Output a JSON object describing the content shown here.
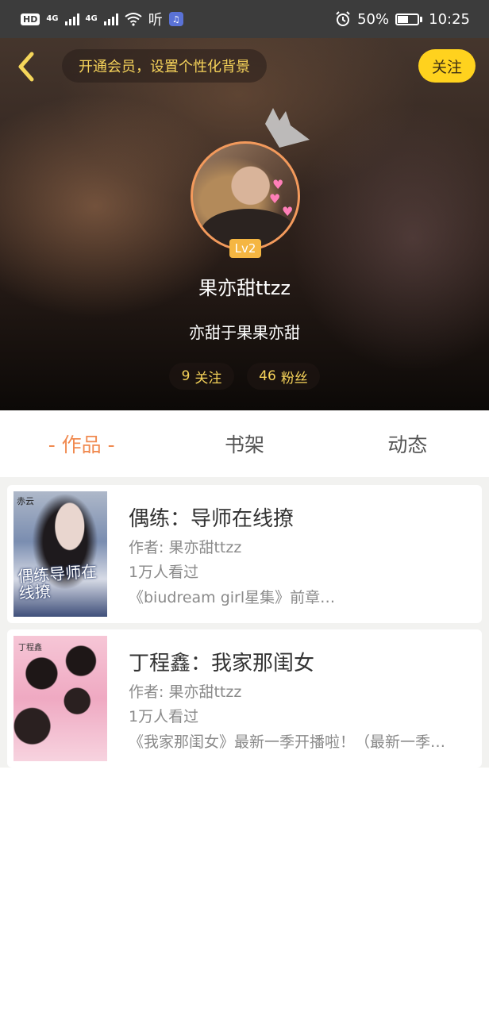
{
  "status_bar": {
    "hd_badge": "HD",
    "net_1": "4G",
    "net_2": "4G",
    "ting_label": "听",
    "battery": "50%",
    "time": "10:25"
  },
  "header": {
    "vip_prompt": "开通会员，设置个性化背景",
    "follow_label": "关注"
  },
  "profile": {
    "level": "Lv2",
    "username": "果亦甜ttzz",
    "bio": "亦甜于果果亦甜",
    "following_count": "9",
    "following_label": "关注",
    "fans_count": "46",
    "fans_label": "粉丝"
  },
  "tabs": [
    {
      "label": "- 作品 -",
      "active": true
    },
    {
      "label": "书架",
      "active": false
    },
    {
      "label": "动态",
      "active": false
    }
  ],
  "books": [
    {
      "title": "偶练：导师在线撩",
      "author": "作者: 果亦甜ttzz",
      "views": "1万人看过",
      "description": "《biudream  girl星集》前章…",
      "cover_text": "偶练导师在线撩"
    },
    {
      "title": "丁程鑫：我家那闺女",
      "author": "作者: 果亦甜ttzz",
      "views": "1万人看过",
      "description": "《我家那闺女》最新一季开播啦！（最新一季…"
    }
  ],
  "colors": {
    "accent_orange": "#f08a50",
    "follow_yellow": "#ffd21e",
    "gold_text": "#f6d35a",
    "avatar_ring": "#f39a5c",
    "level_badge": "#f5b642"
  }
}
